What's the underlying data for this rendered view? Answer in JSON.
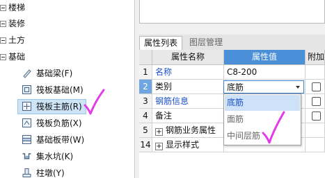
{
  "tree": {
    "categories": [
      {
        "label": "楼梯"
      },
      {
        "label": "装修"
      },
      {
        "label": "土方"
      },
      {
        "label": "基础"
      }
    ],
    "items": [
      {
        "label": "基础梁(F)",
        "icon": "beam-icon"
      },
      {
        "label": "筏板基础(M)",
        "icon": "raft-foundation-icon"
      },
      {
        "label": "筏板主筋(R)",
        "icon": "raft-main-rebar-icon"
      },
      {
        "label": "筏板负筋(X)",
        "icon": "raft-negative-rebar-icon"
      },
      {
        "label": "基础板带(W)",
        "icon": "foundation-strip-icon"
      },
      {
        "label": "集水坑(K)",
        "icon": "sump-pit-icon"
      },
      {
        "label": "柱墩(Y)",
        "icon": "column-pier-icon"
      }
    ]
  },
  "tabs": [
    {
      "label": "属性列表"
    },
    {
      "label": "图层管理"
    }
  ],
  "table": {
    "headers": {
      "name": "属性名称",
      "value": "属性值",
      "extra": "附加"
    },
    "rows": [
      {
        "num": "1",
        "name": "名称",
        "value": "C8-200"
      },
      {
        "num": "2",
        "name": "类别",
        "value": "底筋"
      },
      {
        "num": "3",
        "name": "钢筋信息",
        "value": ""
      },
      {
        "num": "4",
        "name": "备注",
        "value": ""
      },
      {
        "num": "5",
        "name": "钢筋业务属性",
        "value": ""
      },
      {
        "num": "14",
        "name": "显示样式",
        "value": ""
      }
    ]
  },
  "dropdown": {
    "selected": "底筋",
    "options": [
      "底筋",
      "面筋",
      "中间层筋"
    ]
  },
  "colors": {
    "selection": "#cde4f7",
    "header_selected": "#4a8fd8",
    "link_blue": "#1a50c8",
    "annotation": "#e23be8"
  }
}
